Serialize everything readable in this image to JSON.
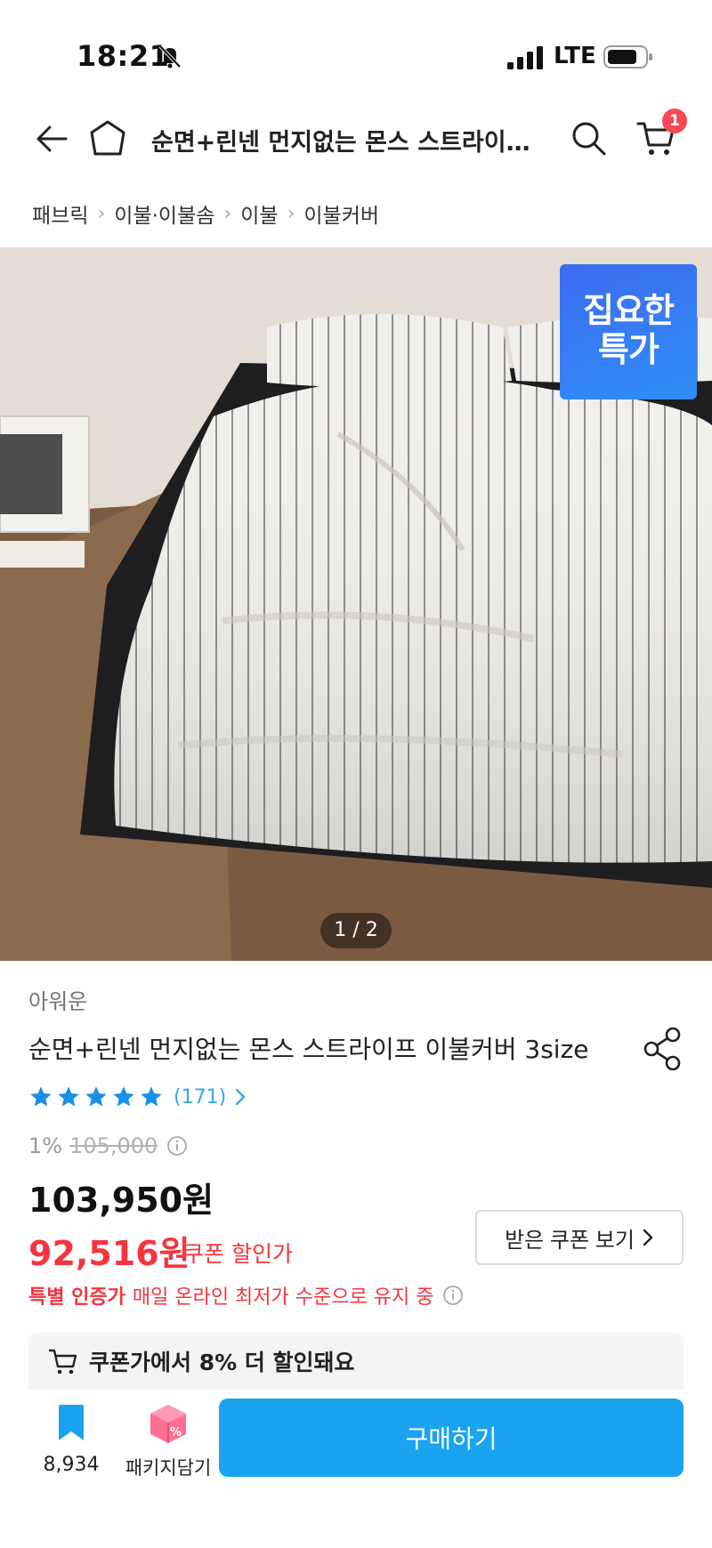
{
  "status": {
    "time": "18:21",
    "network": "LTE"
  },
  "nav": {
    "title": "순면+린넨 먼지없는 몬스 스트라이…",
    "cart_count": "1"
  },
  "breadcrumb": [
    "패브릭",
    "이불·이불솜",
    "이불",
    "이불커버"
  ],
  "hero": {
    "badge_line1": "집요한",
    "badge_line2": "특가",
    "page_indicator": "1 / 2"
  },
  "product": {
    "brand": "아워운",
    "title": "순면+린넨 먼지없는 몬스 스트라이프 이불커버 3size",
    "rating_stars": 5,
    "review_count": "(171)",
    "discount_rate": "1%",
    "original_price": "105,000",
    "sale_price": "103,950원",
    "coupon_price": "92,516원",
    "coupon_price_label": "쿠폰 할인가",
    "coupon_button": "받은 쿠폰 보기",
    "certified_strong": "특별 인증가",
    "certified_text": "매일 온라인 최저가 수준으로 유지 중",
    "coupon_banner": "쿠폰가에서 8% 더 할인돼요"
  },
  "bottom": {
    "bookmark_count": "8,934",
    "package_label": "패키지담기",
    "buy_label": "구매하기"
  },
  "colors": {
    "accent": "#1aa3f0",
    "price_red": "#f5343f",
    "badge_blue": "#3d6bf0",
    "star_blue": "#1a8fe8"
  }
}
